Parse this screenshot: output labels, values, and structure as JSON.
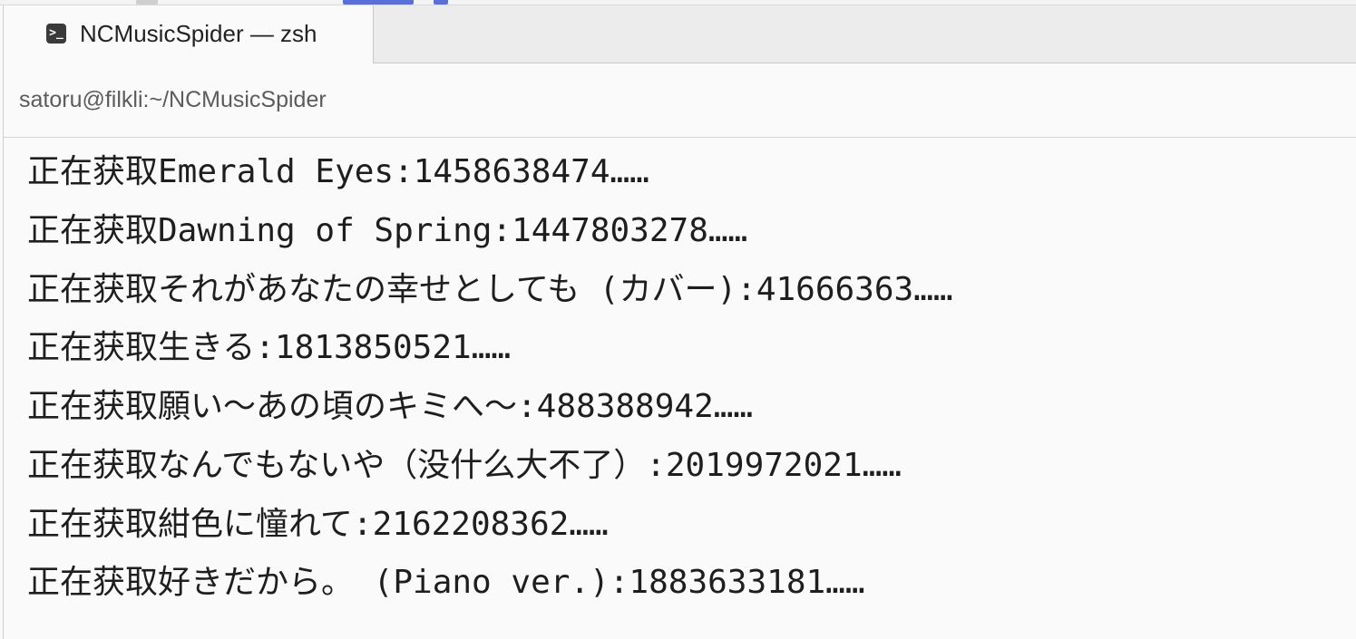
{
  "tab": {
    "title": "NCMusicSpider — zsh",
    "icon": "terminal-prompt-icon"
  },
  "path": "satoru@filkli:~/NCMusicSpider",
  "terminal": {
    "lines": [
      "正在获取Emerald Eyes:1458638474……",
      "正在获取Dawning of Spring:1447803278……",
      "正在获取それがあなたの幸せとしても (カバー):41666363……",
      "正在获取生きる:1813850521……",
      "正在获取願い～あの頃のキミへ～:488388942……",
      "正在获取なんでもないや（没什么大不了）:2019972021……",
      "正在获取紺色に憧れて:2162208362……",
      "正在获取好きだから。 (Piano ver.):1883633181……"
    ]
  },
  "colors": {
    "text": "#1e1e1e",
    "background": "#fafafa",
    "tabbar": "#ececec",
    "path_text": "#5c5c5c"
  }
}
